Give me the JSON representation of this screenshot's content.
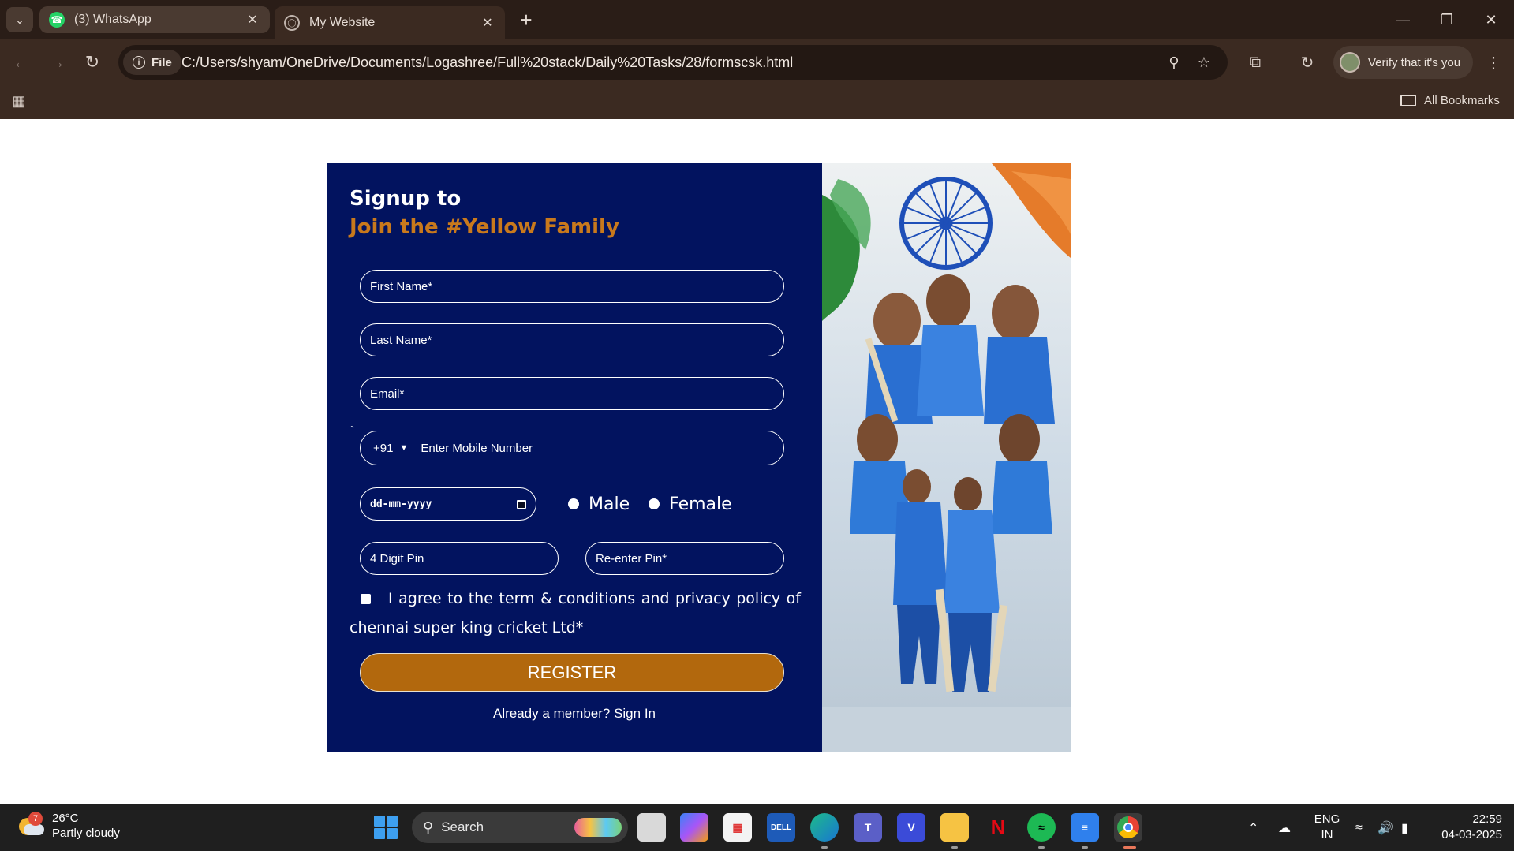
{
  "browser": {
    "tabs": [
      {
        "title": "(3) WhatsApp",
        "icon": "whatsapp-icon",
        "active": false
      },
      {
        "title": "My Website",
        "icon": "globe-icon",
        "active": true
      }
    ],
    "address": {
      "scheme_chip": "File",
      "url": "C:/Users/shyam/OneDrive/Documents/Logashree/Full%20stack/Daily%20Tasks/28/formscsk.html"
    },
    "verify_label": "Verify that it's you",
    "bookmarks_label": "All Bookmarks"
  },
  "form": {
    "heading_line1": "Signup to",
    "heading_line2": "Join the #Yellow Family",
    "first_name_placeholder": "First Name*",
    "last_name_placeholder": "Last Name*",
    "email_placeholder": "Email*",
    "stray_char": "`",
    "country_code": "+91",
    "mobile_placeholder": "Enter Mobile Number",
    "dob_placeholder": "dd-mm-yyyy",
    "gender_options": [
      "Male",
      "Female"
    ],
    "pin_placeholder": "4 Digit Pin",
    "repin_placeholder": "Re-enter Pin*",
    "agree_text": "I agree to the term & conditions and privacy policy of chennai super king cricket Ltd*",
    "register_label": "REGISTER",
    "member_text": "Already a member? Sign In"
  },
  "taskbar": {
    "weather_temp": "26°C",
    "weather_desc": "Partly cloudy",
    "weather_badge": "7",
    "search_label": "Search",
    "lang_line1": "ENG",
    "lang_line2": "IN",
    "time": "22:59",
    "date": "04-03-2025"
  },
  "colors": {
    "form_bg": "#02135f",
    "accent_orange": "#c9791c",
    "register_bg": "#b2680d",
    "chrome_bg": "#3b2a21"
  }
}
